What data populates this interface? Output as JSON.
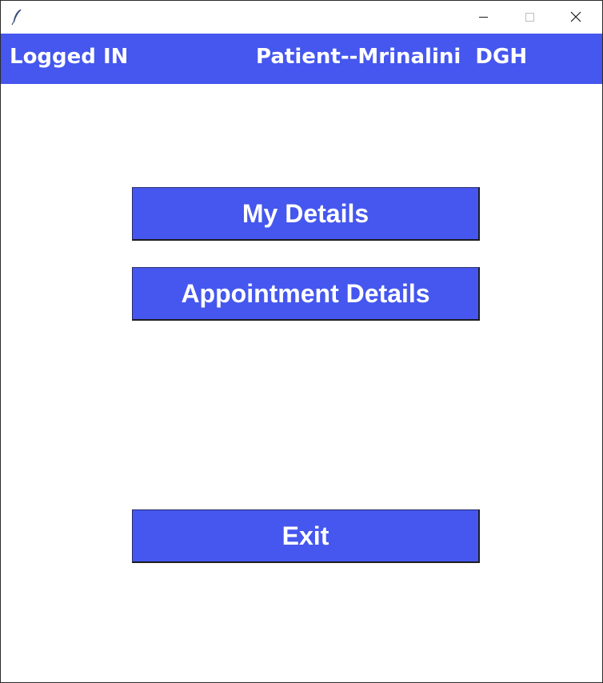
{
  "window": {
    "title": "",
    "controls": {
      "minimize_icon": "minimize-icon",
      "maximize_icon": "maximize-icon",
      "close_icon": "close-icon"
    }
  },
  "header": {
    "status": "Logged IN",
    "patient_info": "Patient--Mrinalini  DGH"
  },
  "actions": {
    "my_details": "My Details",
    "appointment_details": "Appointment Details",
    "exit": "Exit"
  },
  "colors": {
    "accent": "#4557ee",
    "text_on_accent": "#ffffff",
    "background": "#ffffff"
  }
}
